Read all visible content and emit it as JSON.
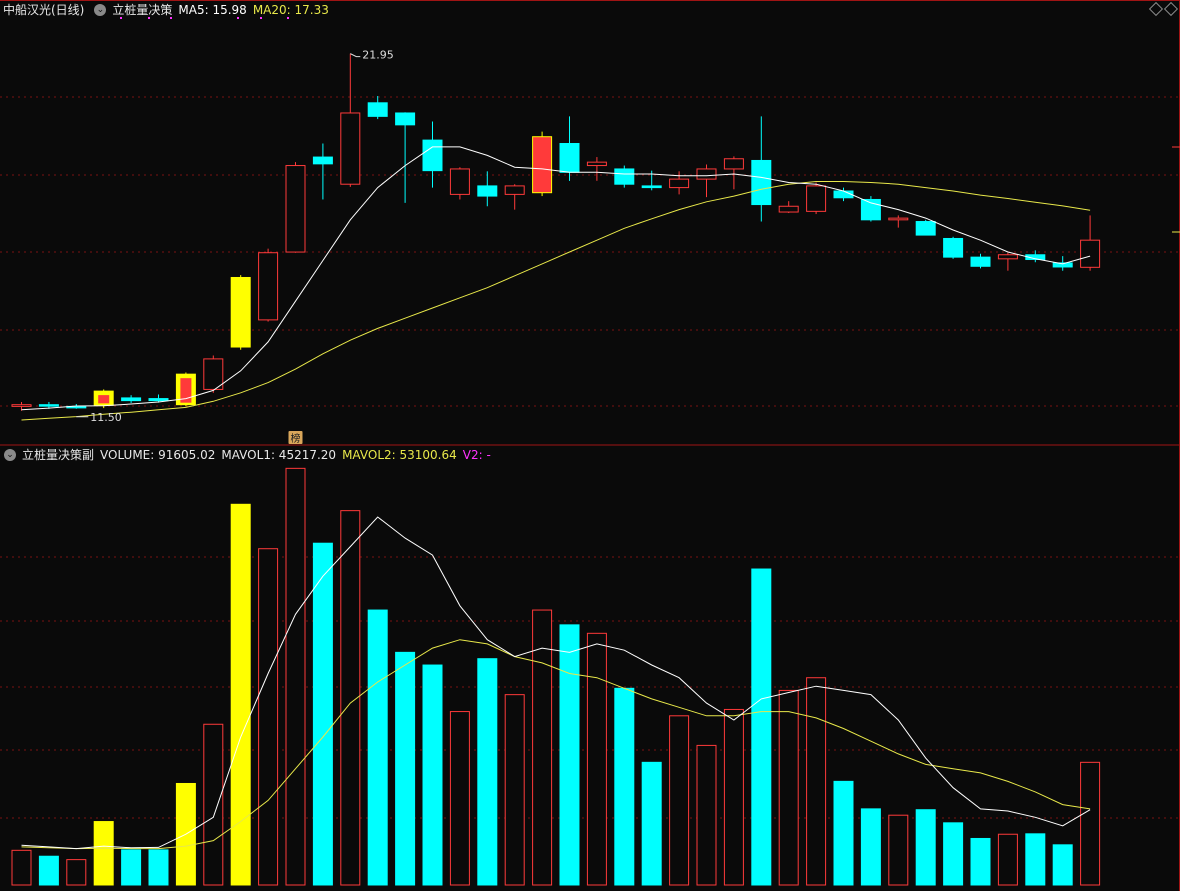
{
  "top_header": {
    "stock": "中船汉光(日线)",
    "indicator": "立桩量决策",
    "ma5_label": "MA5: 15.98",
    "ma20_label": "MA20: 17.33"
  },
  "bottom_header": {
    "indicator": "立桩量决策副",
    "volume_label": "VOLUME: 91605.02",
    "mavol1_label": "MAVOL1: 45217.20",
    "mavol2_label": "MAVOL2: 53100.64",
    "v2_label": "V2: -"
  },
  "colors": {
    "up": "#ff3a3a",
    "down": "#00ffff",
    "signal": "#ffff00",
    "ma5": "#ffffff",
    "ma20": "#e8e84a",
    "grid": "#7a1212",
    "divider": "#a01414",
    "label_magenta": "#ff33ff"
  },
  "chart_data": [
    {
      "type": "candlestick",
      "title": "中船汉光(日线)",
      "ylim": [
        10.5,
        23.0
      ],
      "annotations": [
        "21.95",
        "11.50",
        "榜"
      ],
      "candles": [
        {
          "o": 11.55,
          "h": 11.68,
          "l": 11.42,
          "c": 11.6,
          "s": "up"
        },
        {
          "o": 11.58,
          "h": 11.68,
          "l": 11.48,
          "c": 11.6,
          "s": "down"
        },
        {
          "o": 11.55,
          "h": 11.62,
          "l": 11.48,
          "c": 11.55,
          "s": "down"
        },
        {
          "o": 11.58,
          "h": 12.05,
          "l": 11.5,
          "c": 12.0,
          "s": "signal"
        },
        {
          "o": 11.8,
          "h": 11.88,
          "l": 11.65,
          "c": 11.72,
          "s": "down"
        },
        {
          "o": 11.78,
          "h": 11.9,
          "l": 11.66,
          "c": 11.72,
          "s": "down"
        },
        {
          "o": 11.6,
          "h": 12.55,
          "l": 11.55,
          "c": 12.5,
          "s": "signal"
        },
        {
          "o": 12.05,
          "h": 13.05,
          "l": 11.95,
          "c": 12.95,
          "s": "up"
        },
        {
          "o": 13.3,
          "h": 15.42,
          "l": 13.22,
          "c": 15.35,
          "s": "signal"
        },
        {
          "o": 14.1,
          "h": 16.2,
          "l": 14.05,
          "c": 16.08,
          "s": "up"
        },
        {
          "o": 16.1,
          "h": 18.75,
          "l": 16.08,
          "c": 18.65,
          "s": "up"
        },
        {
          "o": 18.9,
          "h": 19.3,
          "l": 17.65,
          "c": 18.7,
          "s": "down"
        },
        {
          "o": 18.1,
          "h": 21.95,
          "l": 18.02,
          "c": 20.2,
          "s": "up"
        },
        {
          "o": 20.5,
          "h": 20.7,
          "l": 20.02,
          "c": 20.1,
          "s": "down"
        },
        {
          "o": 20.2,
          "h": 20.22,
          "l": 17.55,
          "c": 19.85,
          "s": "down"
        },
        {
          "o": 19.4,
          "h": 19.95,
          "l": 18.0,
          "c": 18.5,
          "s": "down"
        },
        {
          "o": 17.8,
          "h": 18.6,
          "l": 17.65,
          "c": 18.55,
          "s": "up"
        },
        {
          "o": 18.05,
          "h": 18.48,
          "l": 17.45,
          "c": 17.75,
          "s": "down"
        },
        {
          "o": 17.8,
          "h": 18.1,
          "l": 17.35,
          "c": 18.05,
          "s": "up"
        },
        {
          "o": 17.85,
          "h": 19.65,
          "l": 17.75,
          "c": 19.5,
          "s": "signal"
        },
        {
          "o": 19.3,
          "h": 20.1,
          "l": 18.2,
          "c": 18.45,
          "s": "down"
        },
        {
          "o": 18.65,
          "h": 18.9,
          "l": 18.2,
          "c": 18.75,
          "s": "up"
        },
        {
          "o": 18.55,
          "h": 18.65,
          "l": 18.0,
          "c": 18.1,
          "s": "down"
        },
        {
          "o": 18.05,
          "h": 18.5,
          "l": 17.92,
          "c": 18.0,
          "s": "down"
        },
        {
          "o": 18.0,
          "h": 18.48,
          "l": 17.8,
          "c": 18.25,
          "s": "up"
        },
        {
          "o": 18.25,
          "h": 18.68,
          "l": 17.72,
          "c": 18.55,
          "s": "up"
        },
        {
          "o": 18.55,
          "h": 18.92,
          "l": 17.95,
          "c": 18.85,
          "s": "up"
        },
        {
          "o": 18.8,
          "h": 20.1,
          "l": 17.0,
          "c": 17.5,
          "s": "down"
        },
        {
          "o": 17.45,
          "h": 17.6,
          "l": 17.25,
          "c": 17.28,
          "s": "up"
        },
        {
          "o": 17.3,
          "h": 18.15,
          "l": 17.22,
          "c": 18.05,
          "s": "up"
        },
        {
          "o": 17.9,
          "h": 18.0,
          "l": 17.6,
          "c": 17.7,
          "s": "down"
        },
        {
          "o": 17.65,
          "h": 17.75,
          "l": 17.0,
          "c": 17.05,
          "s": "down"
        },
        {
          "o": 17.05,
          "h": 17.18,
          "l": 16.82,
          "c": 17.1,
          "s": "up"
        },
        {
          "o": 17.0,
          "h": 17.05,
          "l": 16.6,
          "c": 16.6,
          "s": "down"
        },
        {
          "o": 16.5,
          "h": 16.55,
          "l": 15.9,
          "c": 15.95,
          "s": "down"
        },
        {
          "o": 15.95,
          "h": 16.05,
          "l": 15.62,
          "c": 15.68,
          "s": "down"
        },
        {
          "o": 15.9,
          "h": 16.08,
          "l": 15.55,
          "c": 16.02,
          "s": "up"
        },
        {
          "o": 16.02,
          "h": 16.15,
          "l": 15.8,
          "c": 15.88,
          "s": "down"
        },
        {
          "o": 15.78,
          "h": 15.98,
          "l": 15.55,
          "c": 15.66,
          "s": "down"
        },
        {
          "o": 15.65,
          "h": 17.18,
          "l": 15.55,
          "c": 16.45,
          "s": "up"
        }
      ],
      "ma5": [
        11.45,
        11.5,
        11.56,
        11.57,
        11.62,
        11.68,
        11.78,
        12.02,
        12.6,
        13.45,
        14.65,
        15.85,
        17.05,
        18.0,
        18.65,
        19.2,
        19.2,
        18.95,
        18.6,
        18.55,
        18.45,
        18.45,
        18.4,
        18.4,
        18.35,
        18.35,
        18.4,
        18.3,
        18.15,
        18.1,
        17.9,
        17.55,
        17.35,
        17.1,
        16.75,
        16.45,
        16.1,
        15.9,
        15.75,
        15.98
      ],
      "ma20": [
        11.15,
        11.2,
        11.25,
        11.32,
        11.38,
        11.45,
        11.52,
        11.7,
        11.95,
        12.25,
        12.65,
        13.1,
        13.5,
        13.85,
        14.15,
        14.45,
        14.75,
        15.05,
        15.4,
        15.75,
        16.1,
        16.45,
        16.8,
        17.08,
        17.35,
        17.58,
        17.75,
        17.95,
        18.1,
        18.18,
        18.18,
        18.15,
        18.1,
        18.0,
        17.9,
        17.78,
        17.68,
        17.57,
        17.46,
        17.33
      ]
    },
    {
      "type": "bar",
      "title": "立桩量决策副",
      "ylim": [
        0,
        100000
      ],
      "volume": [
        8200,
        6800,
        6000,
        15000,
        8300,
        8300,
        24000,
        38000,
        90000,
        79500,
        98500,
        80800,
        88500,
        65000,
        55000,
        52000,
        41000,
        53500,
        45000,
        65000,
        61500,
        59500,
        46500,
        29000,
        40000,
        33000,
        41500,
        74700,
        46000,
        49000,
        24500,
        18000,
        16500,
        17800,
        14700,
        11000,
        12000,
        12100,
        9500,
        29000
      ],
      "styles": [
        "up",
        "down",
        "up",
        "signal",
        "down",
        "down",
        "signal",
        "up",
        "signal",
        "up",
        "up",
        "down",
        "up",
        "down",
        "down",
        "down",
        "up",
        "down",
        "up",
        "up",
        "down",
        "up",
        "down",
        "down",
        "up",
        "up",
        "up",
        "down",
        "up",
        "up",
        "down",
        "down",
        "up",
        "down",
        "down",
        "down",
        "up",
        "down",
        "down",
        "up"
      ],
      "mavol1": [
        9400,
        9000,
        8600,
        9200,
        8800,
        8900,
        12000,
        16000,
        35000,
        50000,
        64000,
        73000,
        80000,
        87000,
        82000,
        78000,
        66000,
        58000,
        54000,
        56000,
        55000,
        57000,
        55500,
        52000,
        49000,
        43000,
        39000,
        44000,
        45500,
        47000,
        46000,
        45000,
        39000,
        30000,
        23000,
        18000,
        17500,
        16000,
        14000,
        17800
      ],
      "mavol2": [
        9000,
        8800,
        8600,
        8700,
        8600,
        8600,
        9200,
        10500,
        15000,
        20000,
        27500,
        35000,
        43000,
        48000,
        52000,
        56000,
        58000,
        57000,
        54000,
        52500,
        50000,
        49000,
        46500,
        44000,
        42000,
        40000,
        40000,
        41000,
        41000,
        39500,
        37000,
        34000,
        31000,
        28500,
        27500,
        26500,
        24500,
        22000,
        19000,
        18000
      ]
    }
  ]
}
